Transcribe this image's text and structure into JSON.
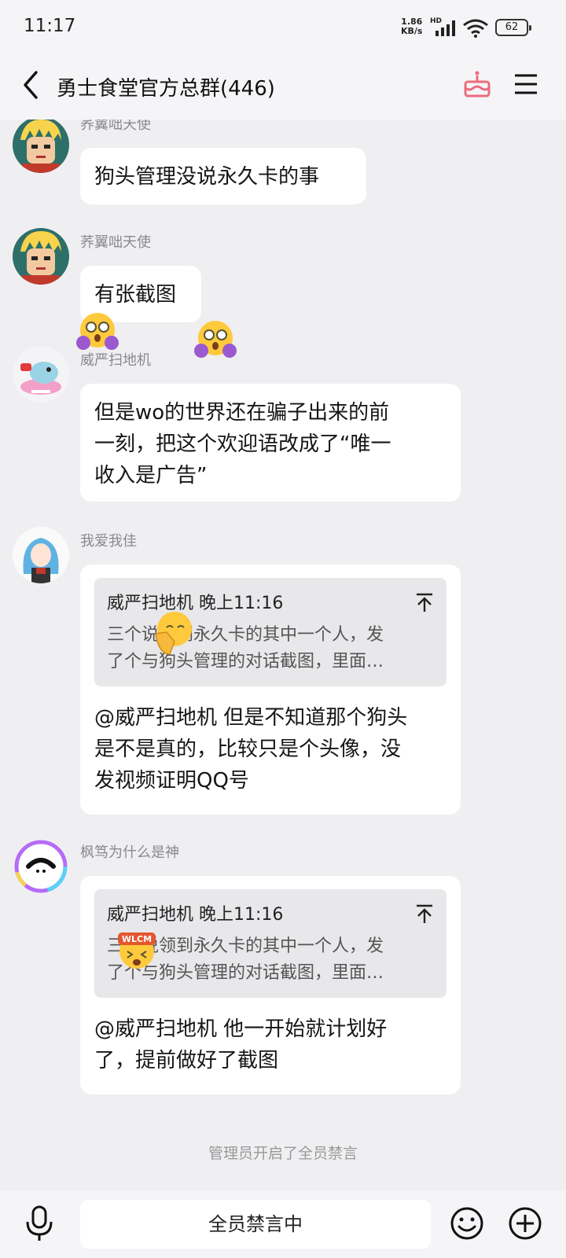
{
  "status": {
    "time": "11:17",
    "net_speed": "1.86",
    "net_unit": "KB/s",
    "hd": "HD",
    "battery": "62"
  },
  "header": {
    "title": "勇士食堂官方总群(446)"
  },
  "messages": [
    {
      "sender": "荞翼咄天使",
      "text": "狗头管理没说永久卡的事"
    },
    {
      "sender": "荞翼咄天使",
      "text": "有张截图"
    },
    {
      "sender": "威严扫地机",
      "lines": [
        "但是wo的世界还在骗子出来的前",
        "一刻，把这个欢迎语改成了“唯一",
        "收入是广告”"
      ]
    },
    {
      "sender": "我爱我佳",
      "quote": {
        "head": "威严扫地机 晚上11:16",
        "lines": [
          "三个说领到永久卡的其中一个人，发",
          "了个与狗头管理的对话截图，里面…"
        ]
      },
      "lines": [
        "@威严扫地机 但是不知道那个狗头",
        "是不是真的，比较只是个头像，没",
        "发视频证明QQ号"
      ]
    },
    {
      "sender": "枫笃为什么是神",
      "quote": {
        "head": "威严扫地机 晚上11:16",
        "lines": [
          "三个说领到永久卡的其中一个人，发",
          "了个与狗头管理的对话截图，里面…"
        ]
      },
      "lines": [
        "@威严扫地机 他一开始就计划好",
        "了，提前做好了截图"
      ]
    }
  ],
  "system_note": "管理员开启了全员禁言",
  "input": {
    "muted_text": "全员禁言中"
  },
  "emoji_labels": {
    "wlcm": "WLCM"
  },
  "colors": {
    "background": "#efeff2",
    "bubble": "#ffffff",
    "quote": "#e8e8eb",
    "cake_accent": "#ec6c7e"
  }
}
